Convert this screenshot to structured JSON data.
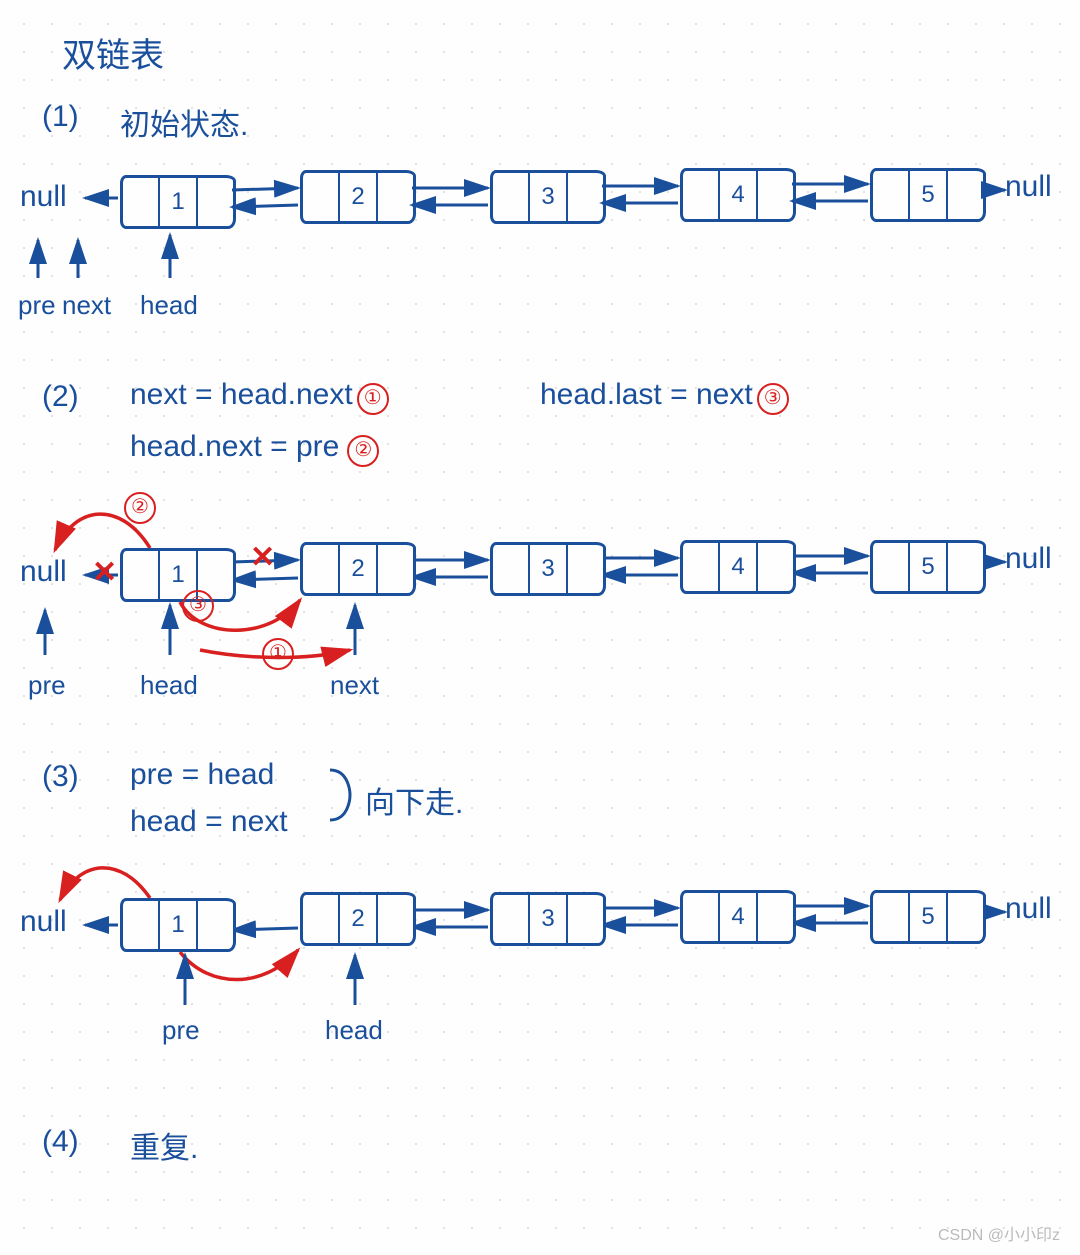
{
  "title": "双链表",
  "watermark": "CSDN @小小印z",
  "steps": {
    "s1": {
      "num": "(1)",
      "label": "初始状态."
    },
    "s2": {
      "num": "(2)",
      "line1_a": "next = head.next",
      "line1_b": "head.last = next",
      "line2": "head.next = pre",
      "c1": "①",
      "c2": "②",
      "c3": "③"
    },
    "s3": {
      "num": "(3)",
      "line1": "pre = head",
      "line2": "head = next",
      "brace_label": "向下走."
    },
    "s4": {
      "num": "(4)",
      "label": "重复."
    }
  },
  "labels": {
    "null_left": "null",
    "null_right": "null",
    "pre": "pre",
    "next": "next",
    "head": "head"
  },
  "nodes": {
    "n1": "1",
    "n2": "2",
    "n3": "3",
    "n4": "4",
    "n5": "5"
  },
  "red_marks": {
    "c1": "①",
    "c2": "②",
    "c3": "③",
    "x": "✕"
  }
}
